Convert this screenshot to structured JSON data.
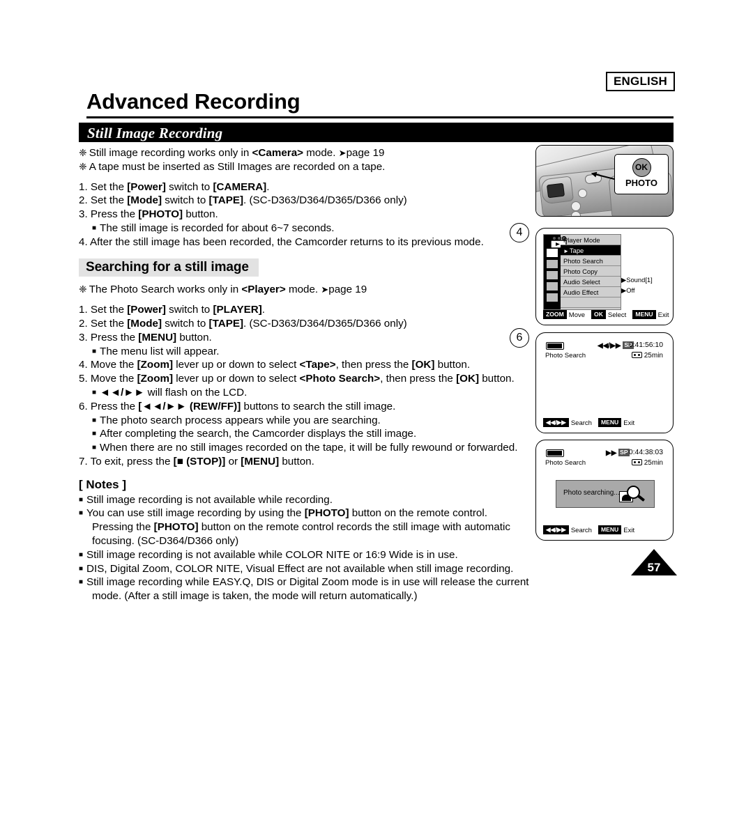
{
  "header": {
    "language_badge": "ENGLISH",
    "chapter_title": "Advanced Recording",
    "section_banner": "Still Image Recording"
  },
  "still_image_recording": {
    "bullets": [
      "Still image recording works only in <Camera> mode. ➡page 19",
      "A tape must be inserted as Still Images are recorded on a tape."
    ],
    "steps": [
      "1. Set the [Power] switch to [CAMERA].",
      "2. Set the [Mode] switch to [TAPE]. (SC-D363/D364/D365/D366 only)",
      "3. Press the [PHOTO] button.",
      "The still image is recorded for about 6~7 seconds.",
      "4. After the still image has been recorded, the Camcorder returns to its previous mode."
    ]
  },
  "searching": {
    "heading": "Searching for a still image",
    "bullet": "The Photo Search works only in <Player> mode. ➡page 19",
    "steps": [
      "1. Set the [Power] switch to [PLAYER].",
      "2. Set the [Mode] switch to [TAPE]. (SC-D363/D364/D365/D366 only)",
      "3. Press the [MENU] button.",
      "The menu list will appear.",
      "4. Move the [Zoom] lever up or down to select <Tape>, then press the [OK] button.",
      "5. Move the [Zoom] lever up or down to select <Photo Search>, then press the [OK] button.",
      "◀◀/▶▶ will flash on the LCD.",
      "6. Press the [◀◀/▶▶ (REW/FF)] buttons to search the still image.",
      "The photo search process appears while you are searching.",
      "After completing the search, the Camcorder displays the still image.",
      "When there are no still images recorded on the tape, it will be fully rewound or forwarded.",
      "7. To exit, press the [■ (STOP)] or [MENU] button."
    ]
  },
  "notes": {
    "heading": "[ Notes ]",
    "items": [
      "Still image recording is not available while recording.",
      "You can use still image recording by using the [PHOTO] button on the remote control. Pressing the [PHOTO] button on the remote control records the still image with automatic focusing. (SC-D364/D366 only)",
      "Still image recording is not available while COLOR NITE or 16:9 Wide is in use.",
      "DIS, Digital Zoom, COLOR NITE, Visual Effect are not available when still image recording.",
      "Still image recording while EASY.Q, DIS or Digital Zoom mode is in use will release the current mode. (After a still image is taken, the mode will return automatically.)"
    ]
  },
  "step_markers": {
    "marker_4": "4",
    "marker_6": "6"
  },
  "camcorder_callout": {
    "ok_label": "OK",
    "photo_label": "PHOTO"
  },
  "menu_panel": {
    "title": "Player Mode",
    "rows": [
      {
        "label": "Tape",
        "value": "",
        "highlight": true,
        "marker": "▶"
      },
      {
        "label": "Photo Search",
        "value": "",
        "highlight": false,
        "marker": ""
      },
      {
        "label": "Photo Copy",
        "value": "",
        "highlight": false,
        "marker": ""
      },
      {
        "label": "Audio Select",
        "value": "▶Sound[1]",
        "highlight": false,
        "marker": ""
      },
      {
        "label": "Audio Effect",
        "value": "▶Off",
        "highlight": false,
        "marker": ""
      }
    ],
    "bottom_bar": [
      {
        "key": "ZOOM",
        "label": "Move"
      },
      {
        "key": "OK",
        "label": "Select"
      },
      {
        "key": "MENU",
        "label": "Exit"
      }
    ]
  },
  "lcd_search": {
    "mode_label": "Photo Search",
    "transport": "◀◀/▶▶",
    "sp": "SP",
    "timecode": "0:41:56:10",
    "remaining": "25min",
    "bottom_bar": [
      {
        "key": "◀◀/▶▶",
        "label": "Search"
      },
      {
        "key": "MENU",
        "label": "Exit"
      }
    ]
  },
  "lcd_searching": {
    "mode_label": "Photo Search",
    "transport": "▶▶",
    "sp": "SP",
    "timecode": "0:44:38:03",
    "remaining": "25min",
    "status_message": "Photo searching...",
    "bottom_bar": [
      {
        "key": "◀◀/▶▶",
        "label": "Search"
      },
      {
        "key": "MENU",
        "label": "Exit"
      }
    ]
  },
  "page_number": "57"
}
